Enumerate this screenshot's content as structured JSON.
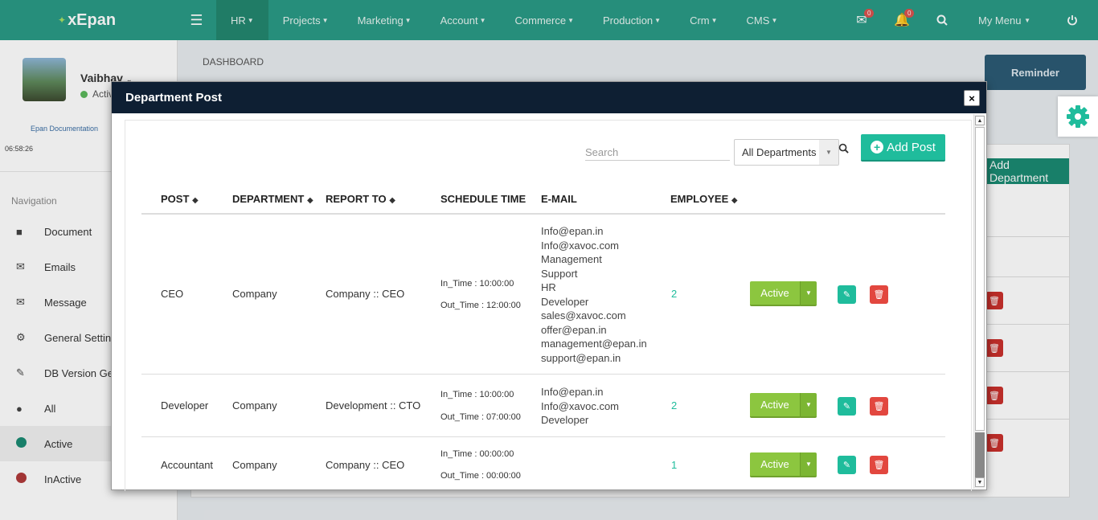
{
  "topbar": {
    "brand": "xEpan",
    "menu": [
      "HR",
      "Projects",
      "Marketing",
      "Account",
      "Commerce",
      "Production",
      "Crm",
      "CMS"
    ],
    "mail_badge": "0",
    "bell_badge": "0",
    "my_menu": "My Menu"
  },
  "sidebar": {
    "user_name": "Vaibhav",
    "user_status": "Active",
    "doc_link": "Epan Documentation",
    "clock": "06:58:26",
    "nav_heading": "Navigation",
    "items": [
      {
        "label": "Document"
      },
      {
        "label": "Emails"
      },
      {
        "label": "Message"
      },
      {
        "label": "General Settings"
      },
      {
        "label": "DB Version Generator"
      },
      {
        "label": "All"
      },
      {
        "label": "Active"
      },
      {
        "label": "InActive"
      }
    ]
  },
  "main": {
    "breadcrumb": "DASHBOARD",
    "reminder": "Reminder",
    "add_department": "Add Department"
  },
  "modal": {
    "title": "Department Post",
    "close": "×",
    "search_placeholder": "Search",
    "department_filter": "All Departments",
    "add_post": "Add Post",
    "columns": {
      "post": "POST",
      "department": "DEPARTMENT",
      "report_to": "REPORT TO",
      "schedule": "SCHEDULE TIME",
      "email": "E-MAIL",
      "employee": "EMPLOYEE"
    },
    "rows": [
      {
        "post": "CEO",
        "department": "Company",
        "report_to": "Company :: CEO",
        "in_time": "In_Time : 10:00:00",
        "out_time": "Out_Time : 12:00:00",
        "emails": [
          "Info@epan.in",
          "Info@xavoc.com",
          "Management",
          "Support",
          "HR",
          "Developer",
          "sales@xavoc.com",
          "offer@epan.in",
          "management@epan.in",
          "support@epan.in"
        ],
        "employee": "2",
        "status": "Active"
      },
      {
        "post": "Developer",
        "department": "Company",
        "report_to": "Development :: CTO",
        "in_time": "In_Time : 10:00:00",
        "out_time": "Out_Time : 07:00:00",
        "emails": [
          "Info@epan.in",
          "Info@xavoc.com",
          "Developer"
        ],
        "employee": "2",
        "status": "Active"
      },
      {
        "post": "Accountant",
        "department": "Company",
        "report_to": "Company :: CEO",
        "in_time": "In_Time : 00:00:00",
        "out_time": "Out_Time : 00:00:00",
        "emails": [],
        "employee": "1",
        "status": "Active"
      }
    ]
  },
  "colors": {
    "topbar": "#2a9b86",
    "modal_header": "#0e1f33",
    "teal": "#1fbc9c",
    "active_green": "#8cc63f",
    "danger": "#e2473f"
  }
}
